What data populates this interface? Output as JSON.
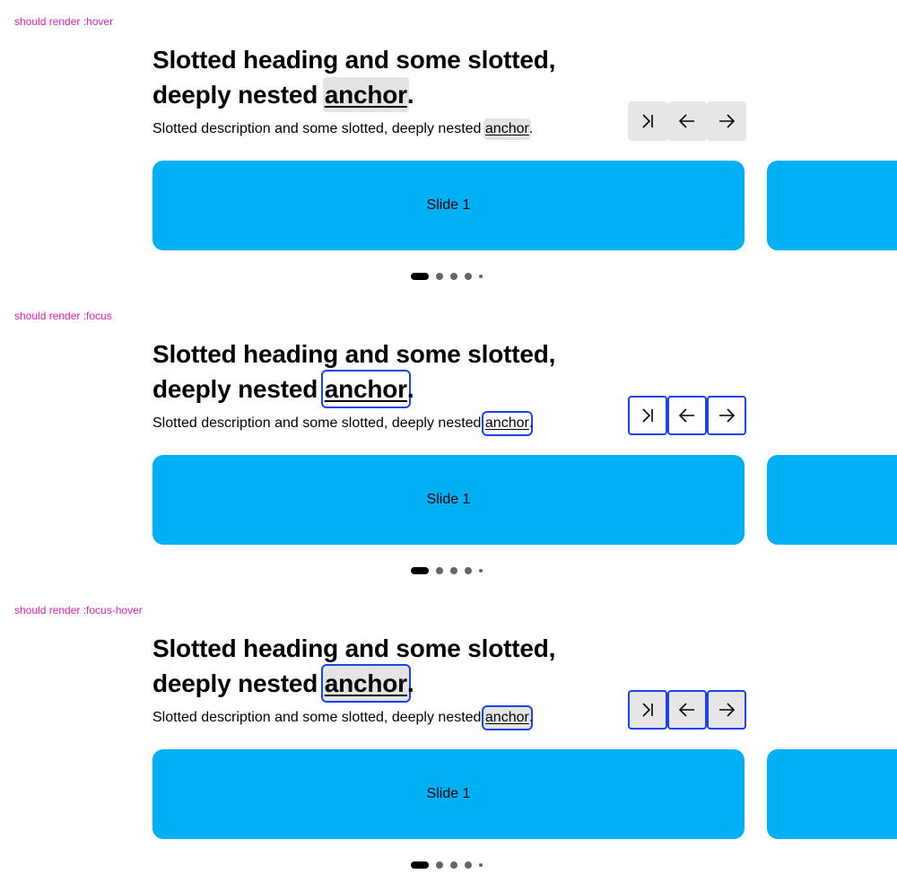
{
  "sections": [
    {
      "label": "should render :hover",
      "state": "hover",
      "heading_text": "Slotted heading and some slotted, deeply nested ",
      "heading_anchor": "anchor",
      "heading_end": ".",
      "desc_text": "Slotted description and some slotted, deeply nested ",
      "desc_anchor": "anchor",
      "desc_end": ".",
      "slide_label": "Slide 1"
    },
    {
      "label": "should render :focus",
      "state": "focus",
      "heading_text": "Slotted heading and some slotted, deeply nested ",
      "heading_anchor": "anchor",
      "heading_end": ".",
      "desc_text": "Slotted description and some slotted, deeply nested ",
      "desc_anchor": "anchor",
      "desc_end": ".",
      "slide_label": "Slide 1"
    },
    {
      "label": "should render :focus-hover",
      "state": "focus-hover",
      "heading_text": "Slotted heading and some slotted, deeply nested ",
      "heading_anchor": "anchor",
      "heading_end": ".",
      "desc_text": "Slotted description and some slotted, deeply nested ",
      "desc_anchor": "anchor",
      "desc_end": ".",
      "slide_label": "Slide 1"
    }
  ],
  "nav_icons": [
    "skip-to-end-icon",
    "arrow-left-icon",
    "arrow-right-icon"
  ],
  "pagination": {
    "total_visible": 5,
    "active_index": 0
  },
  "colors": {
    "slide": "#00b0f4",
    "focus": "#1a44ea",
    "hover_bg": "#e4e4e4",
    "label": "#e020b0"
  }
}
